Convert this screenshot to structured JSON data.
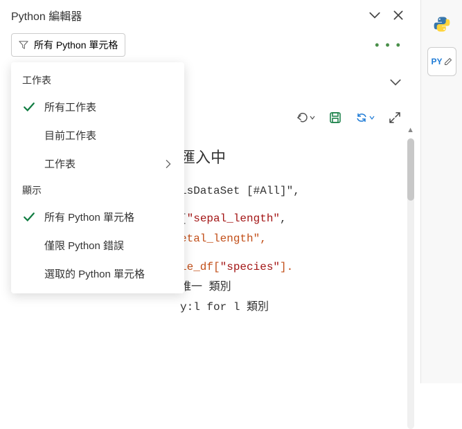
{
  "header": {
    "title": "Python 編輯器"
  },
  "toolbar": {
    "filter_label": "所有 Python 單元格"
  },
  "menu": {
    "section1": "工作表",
    "items1": [
      {
        "label": "所有工作表",
        "checked": true,
        "has_caret": false
      },
      {
        "label": "目前工作表",
        "checked": false,
        "has_caret": false
      },
      {
        "label": "工作表",
        "checked": false,
        "has_caret": true
      }
    ],
    "section2": "顯示",
    "items2": [
      {
        "label": "所有 Python 單元格",
        "checked": true
      },
      {
        "label": "僅限 Python 錯誤",
        "checked": false
      },
      {
        "label": "選取的 Python 單元格",
        "checked": false
      }
    ]
  },
  "code": {
    "heading": "匯入中",
    "line1": "isDataSet [#All]\",",
    "line2a": "[\"sepal_length\",",
    "line2b": "etal_length\",",
    "line3": "le_df[\"species\"].",
    "line4": "唯一 類別",
    "line5": "y:l for l 類別"
  },
  "rail": {
    "py_label": "PY"
  }
}
